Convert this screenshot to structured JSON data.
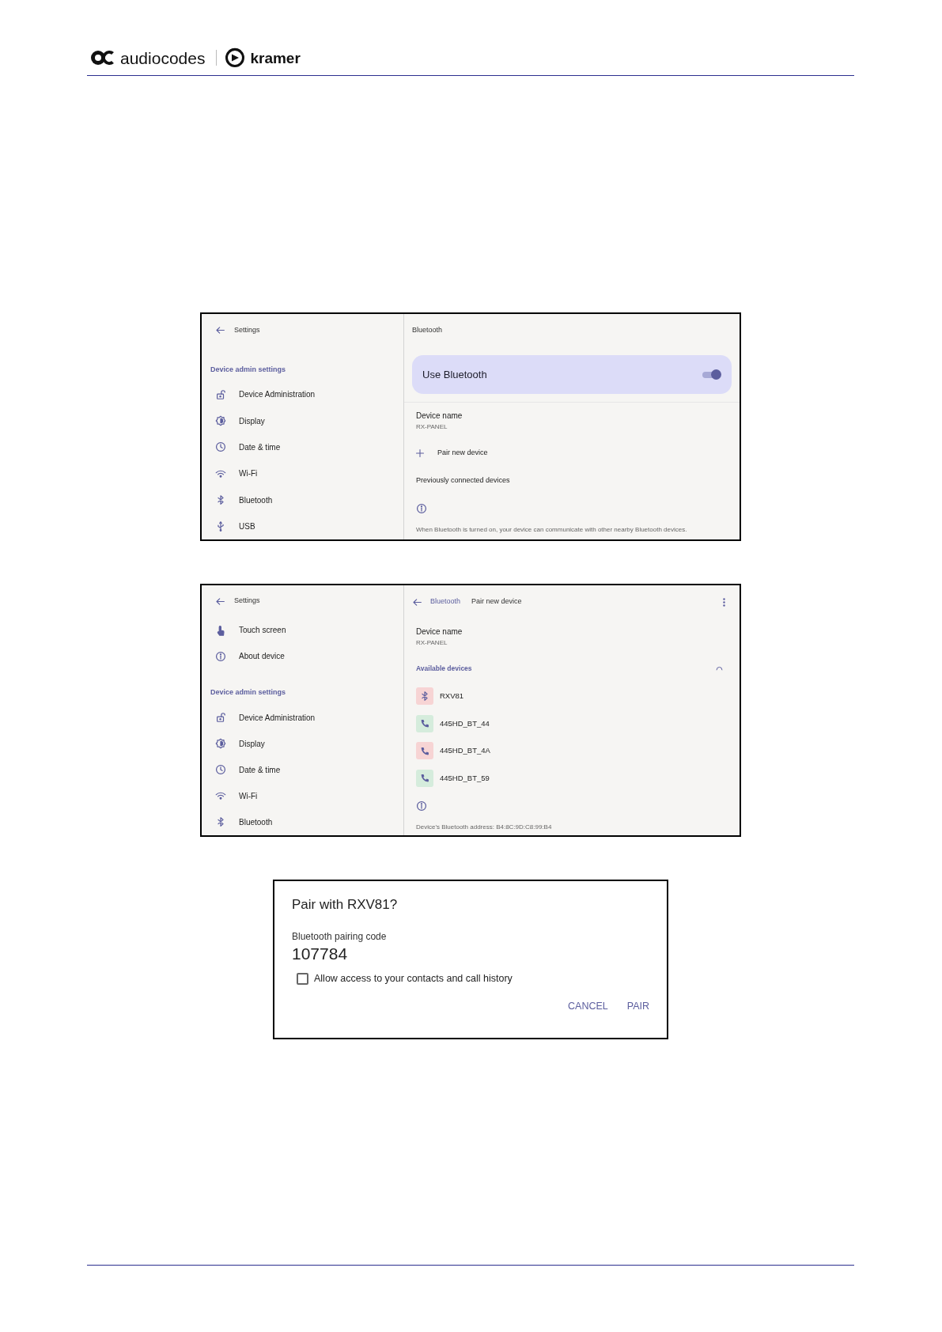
{
  "header": {
    "brand_primary": "audiocodes",
    "brand_secondary": "kramer"
  },
  "screenshots": [
    {
      "sidebar": {
        "back_label": "Settings",
        "items": [
          {
            "kind": "section",
            "label": "Device admin settings"
          },
          {
            "kind": "admin",
            "label": "Device Administration"
          },
          {
            "kind": "display",
            "label": "Display"
          },
          {
            "kind": "datetime",
            "label": "Date & time"
          },
          {
            "kind": "wifi",
            "label": "Wi-Fi"
          },
          {
            "kind": "bluetooth",
            "label": "Bluetooth"
          },
          {
            "kind": "usb",
            "label": "USB"
          }
        ]
      },
      "panel": {
        "title": "Bluetooth",
        "rows": [
          {
            "kind": "toggle",
            "label": "Use Bluetooth",
            "on": true
          },
          {
            "kind": "device_name",
            "label": "Device name",
            "value": "RX-PANEL"
          },
          {
            "kind": "action",
            "label": "Pair new device"
          },
          {
            "kind": "subheader",
            "label": "Previously connected devices"
          },
          {
            "kind": "info"
          },
          {
            "kind": "footnote",
            "label": "When Bluetooth is turned on, your device can communicate with other nearby Bluetooth devices."
          }
        ]
      }
    },
    {
      "sidebar": {
        "back_label": "Settings",
        "items": [
          {
            "kind": "touch",
            "label": "Touch screen"
          },
          {
            "kind": "about",
            "label": "About device"
          },
          {
            "kind": "section",
            "label": "Device admin settings"
          },
          {
            "kind": "admin",
            "label": "Device Administration"
          },
          {
            "kind": "display",
            "label": "Display"
          },
          {
            "kind": "datetime",
            "label": "Date & time"
          },
          {
            "kind": "wifi",
            "label": "Wi-Fi"
          },
          {
            "kind": "bluetooth",
            "label": "Bluetooth"
          }
        ]
      },
      "panel": {
        "parent": "Bluetooth",
        "title": "Pair new device",
        "rows": [
          {
            "kind": "device_name",
            "label": "Device name",
            "value": "RX-PANEL"
          },
          {
            "kind": "section",
            "label": "Available devices"
          },
          {
            "kind": "bluetooth_device",
            "label": "RXV81",
            "color": "#f7d4d4"
          },
          {
            "kind": "phone_device",
            "label": "445HD_BT_44",
            "color": "#d5ecdc"
          },
          {
            "kind": "phone_device",
            "label": "445HD_BT_4A",
            "color": "#f7d4d4"
          },
          {
            "kind": "phone_device",
            "label": "445HD_BT_59",
            "color": "#d5ecdc"
          },
          {
            "kind": "info"
          },
          {
            "kind": "footnote",
            "label": "Device's Bluetooth address: B4:8C:9D:C8:99:B4"
          }
        ]
      }
    }
  ],
  "dialog": {
    "title": "Pair with RXV81?",
    "code_label": "Bluetooth pairing code",
    "code": "107784",
    "checkbox": {
      "label": "Allow access to your contacts and call history",
      "checked": false
    },
    "buttons": [
      "CANCEL",
      "PAIR"
    ]
  }
}
